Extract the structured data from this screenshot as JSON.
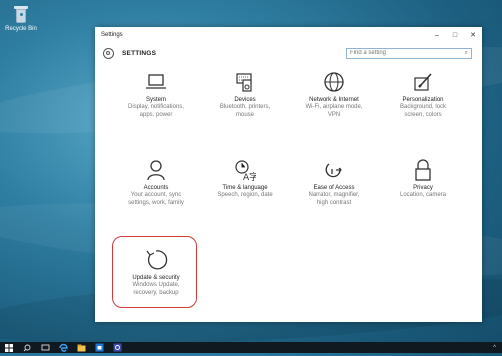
{
  "desktop": {
    "recycle_bin_label": "Recycle Bin"
  },
  "window": {
    "title": "Settings",
    "controls": {
      "minimize": "–",
      "maximize": "□",
      "close": "✕"
    }
  },
  "header": {
    "title": "SETTINGS",
    "search_placeholder": "Find a setting"
  },
  "tiles": [
    {
      "name": "System",
      "desc1": "Display, notifications,",
      "desc2": "apps, power",
      "icon": "laptop-icon"
    },
    {
      "name": "Devices",
      "desc1": "Bluetooth, printers,",
      "desc2": "mouse",
      "icon": "keyboard-speaker-icon"
    },
    {
      "name": "Network & Internet",
      "desc1": "Wi-Fi, airplane mode,",
      "desc2": "VPN",
      "icon": "globe-icon"
    },
    {
      "name": "Personalization",
      "desc1": "Background, lock",
      "desc2": "screen, colors",
      "icon": "brush-icon"
    },
    {
      "name": "Accounts",
      "desc1": "Your account, sync",
      "desc2": "settings, work, family",
      "icon": "person-icon"
    },
    {
      "name": "Time & language",
      "desc1": "Speech, region, date",
      "desc2": "",
      "icon": "language-icon"
    },
    {
      "name": "Ease of Access",
      "desc1": "Narrator, magnifier,",
      "desc2": "high contrast",
      "icon": "ease-of-access-icon"
    },
    {
      "name": "Privacy",
      "desc1": "Location, camera",
      "desc2": "",
      "icon": "lock-icon"
    },
    {
      "name": "Update & security",
      "desc1": "Windows Update,",
      "desc2": "recovery, backup",
      "icon": "refresh-icon"
    }
  ],
  "colors": {
    "highlight": "#d13a3a",
    "search_border": "#8fb4d8"
  },
  "taskbar": {
    "items": [
      "start-icon",
      "search-icon",
      "task-view-icon",
      "edge-icon",
      "file-explorer-icon",
      "store-icon",
      "settings-icon"
    ],
    "tray": "^"
  }
}
